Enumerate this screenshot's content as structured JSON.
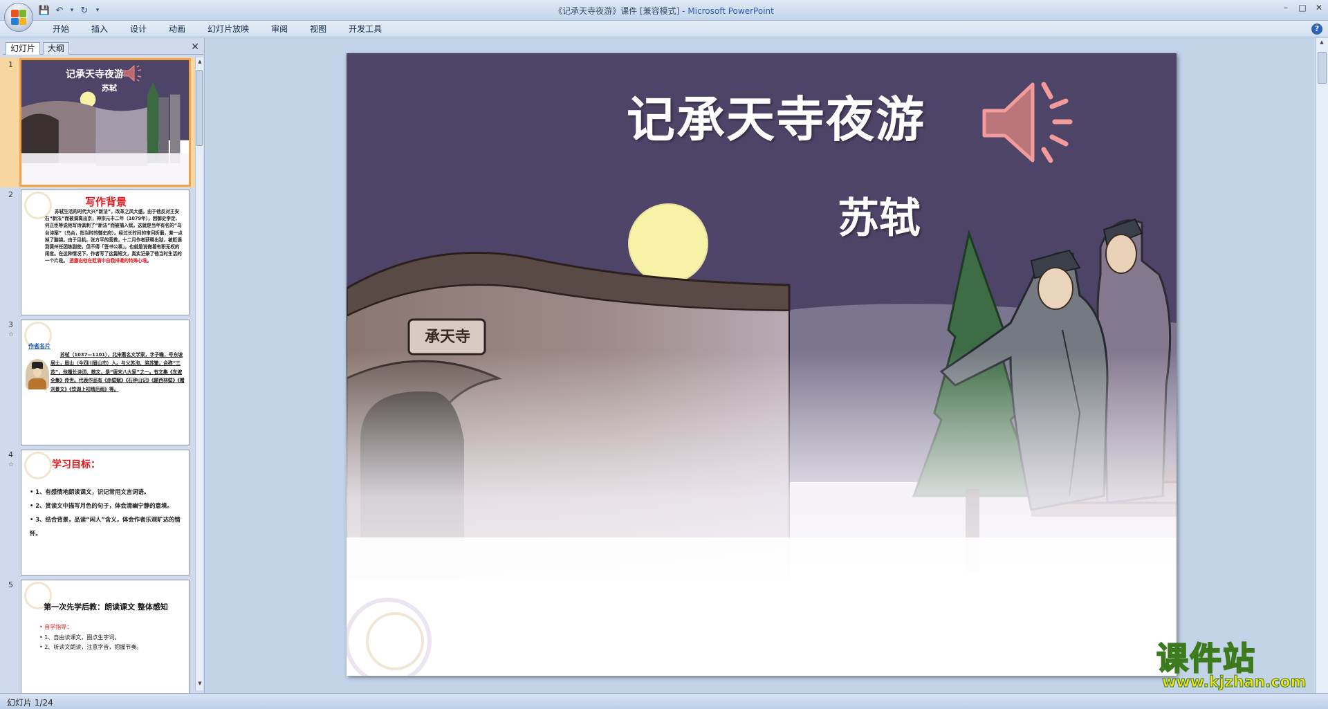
{
  "window": {
    "title": "《记承天寺夜游》课件 [兼容模式] - ",
    "app_name": "Microsoft PowerPoint",
    "minimize": "–",
    "maximize": "□",
    "close": "✕"
  },
  "qat": {
    "save": "💾",
    "undo": "↶",
    "undo_more": "▾",
    "redo": "↻",
    "customize": "▾"
  },
  "ribbon": {
    "tabs": [
      "开始",
      "插入",
      "设计",
      "动画",
      "幻灯片放映",
      "审阅",
      "视图",
      "开发工具"
    ],
    "help": "?"
  },
  "left_pane": {
    "tab_slides": "幻灯片",
    "tab_outline": "大纲",
    "close": "✕",
    "thumbnails": [
      {
        "number": "1",
        "title": "记承天寺夜游",
        "author": "苏轼"
      },
      {
        "number": "2",
        "title": "写作背景",
        "body": "苏轼生活的时代大兴“新法”，改革之风大盛。由于他反对王安石“新法”而被调离出京，神宗元丰二年（1079年），因御史李定、何正臣等说他写诗讽刺了“新法”而被捕入狱。这就是当年有名的“乌台诗案”（乌台，指当时的御史府）。经过长时间的审问折磨，差一点掉了脑袋。由于见机，张方平的营救，十二月作者获释出狱，被贬谪到黄州任团练副使，但不得「签书公事」，也就是说做着有职无权的闲官。在这种情况下，作者写了这篇短文，真实记录了他当时生活的一个片段。",
        "highlight_inline": "乌台诗案",
        "highlight_tail": "透露出他在贬谪中自我排遣的特殊心境。"
      },
      {
        "number": "3",
        "star": "☆",
        "heading": "作者名片",
        "body": "苏轼（1037—1101），北宋著名文学家，字子瞻，号东坡居士，眉山（今四川眉山市）人。与父苏洵、弟苏辙，合称“三苏”，他擅长诗词、散文，是“唐宋八大家”之一。有文集《东坡全集》传世。代表作品有《赤壁赋》《石钟山记》《题西林壁》《赠刘景文》《饮湖上初晴后雨》等。"
      },
      {
        "number": "4",
        "star": "☆",
        "heading": "学习目标：",
        "items": [
          "1、有感情地朗读课文，识记常用文言词语。",
          "2、赏读文中描写月色的句子，体会清幽宁静的意境。",
          "3、结合背景，品读“闲人”含义，体会作者乐观旷达的情怀。"
        ]
      },
      {
        "number": "5",
        "heading": "第一次先学后教：朗读课文 整体感知",
        "sub": "自学指导：",
        "items": [
          "1、自由读课文，圈点生字词。",
          "2、听读文朗读，注意字音，把握节奏。"
        ]
      }
    ]
  },
  "slide": {
    "title": "记承天寺夜游",
    "author": "苏轼",
    "plaque": "承天寺",
    "speaker_icon": "speaker-icon"
  },
  "status": {
    "slide_counter": "幻灯片 1/24"
  },
  "watermark": {
    "main": "课件站",
    "url": "www.kjzhan.com"
  },
  "colors": {
    "sky": "#4e4467",
    "moon": "#f8f2a6",
    "title_text": "#ffffff",
    "accent_red": "#e8151b",
    "selection": "#f2a24a"
  }
}
